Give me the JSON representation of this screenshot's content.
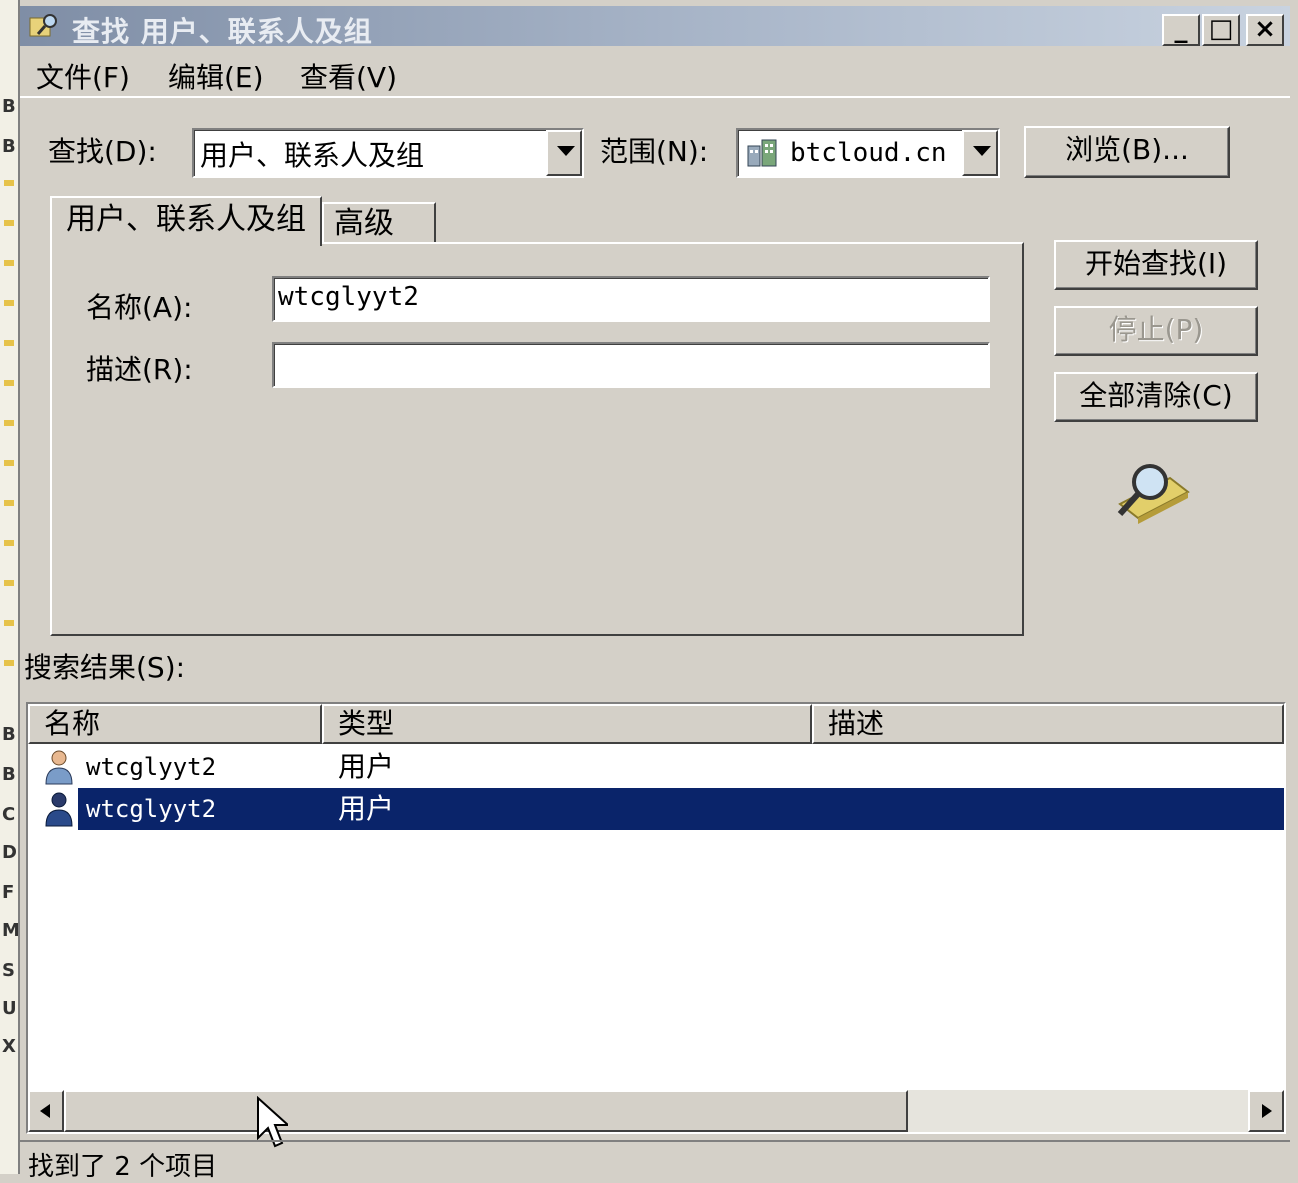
{
  "window": {
    "title": "查找 用户、联系人及组",
    "minimize_label": "_",
    "maximize_label": "□",
    "close_label": "×"
  },
  "menu": {
    "file": "文件(F)",
    "edit": "编辑(E)",
    "view": "查看(V)"
  },
  "search": {
    "find_label": "查找(D):",
    "find_value": "用户、联系人及组",
    "scope_label": "范围(N):",
    "scope_value": "btcloud.cn",
    "browse_button": "浏览(B)..."
  },
  "tabs": [
    {
      "label": "用户、联系人及组",
      "active": true
    },
    {
      "label": "高级",
      "active": false
    }
  ],
  "form": {
    "name_label": "名称(A):",
    "name_value": "wtcglyyt2",
    "description_label": "描述(R):",
    "description_value": ""
  },
  "actions": {
    "find_now": "开始查找(I)",
    "stop": "停止(P)",
    "clear_all": "全部清除(C)"
  },
  "results": {
    "label": "搜索结果(S):",
    "columns": [
      "名称",
      "类型",
      "描述"
    ],
    "rows": [
      {
        "name": "wtcglyyt2",
        "type": "用户",
        "description": "",
        "selected": false
      },
      {
        "name": "wtcglyyt2",
        "type": "用户",
        "description": "",
        "selected": true
      }
    ]
  },
  "status": {
    "text": "找到了 2 个项目"
  },
  "background_strip_letters": [
    "B",
    "B",
    "B",
    "B",
    "C",
    "D",
    "F",
    "M",
    "S",
    "U",
    "X"
  ],
  "colors": {
    "selection": "#0a246a",
    "face": "#d4d0c8"
  }
}
